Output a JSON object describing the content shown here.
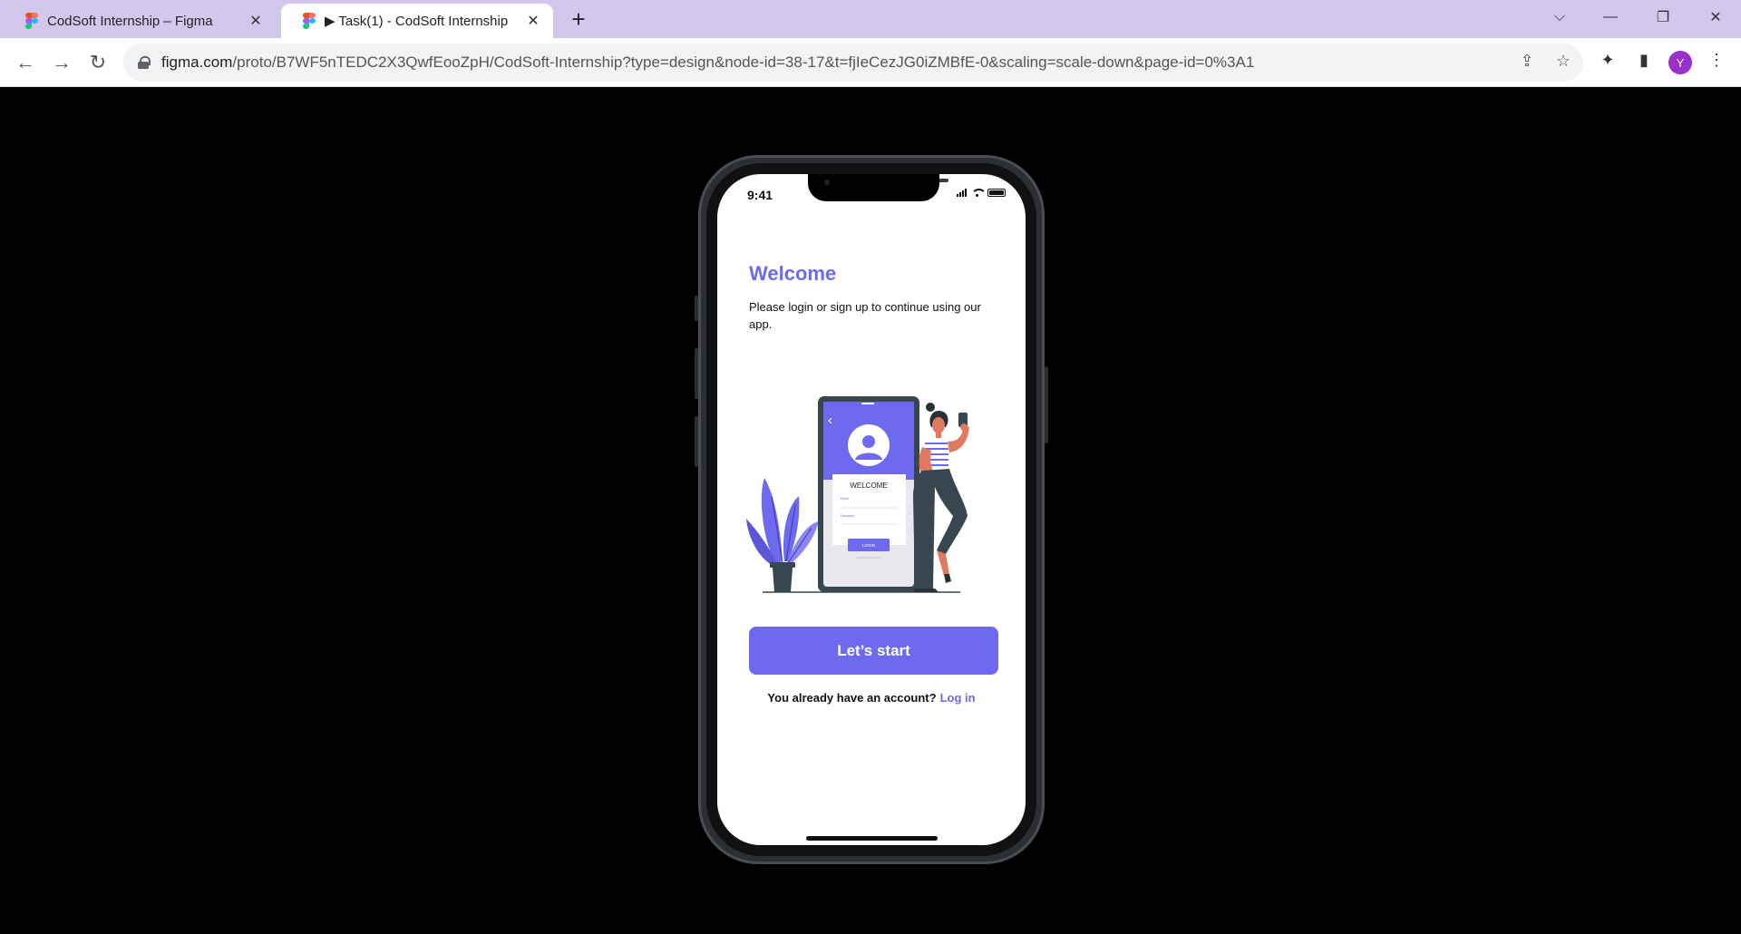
{
  "browser": {
    "tabs": [
      {
        "title": "CodSoft Internship – Figma",
        "active": false
      },
      {
        "title": "▶ Task(1) - CodSoft Internship",
        "active": true
      }
    ],
    "new_tab_label": "+",
    "close_glyph": "✕",
    "window_controls": {
      "tab_search": "⌵",
      "minimize": "—",
      "restore": "❐",
      "close": "✕"
    },
    "nav": {
      "back": "←",
      "forward": "→",
      "reload": "↻"
    },
    "url_host": "figma.com",
    "url_path": "/proto/B7WF5nTEDC2X3QwfEooZpH/CodSoft-Internship?type=design&node-id=38-17&t=fjIeCezJG0iZMBfE-0&scaling=scale-down&page-id=0%3A1",
    "toolbar_icons": {
      "share": "⇪",
      "bookmark": "☆",
      "extensions": "✦",
      "side_panel": "▮"
    },
    "profile_initial": "Y"
  },
  "phone": {
    "status_time": "9:41",
    "title": "Welcome",
    "subtitle": "Please login or sign up to continue using our app.",
    "illustration": {
      "screen_heading": "WELCOME",
      "email_label": "Email",
      "password_label": "Password",
      "login_label": "LOGIN"
    },
    "primary_button": "Let’s start",
    "login_prompt": "You already have an account?",
    "login_link": "Log in"
  },
  "colors": {
    "accent": "#6e6af0",
    "tab_strip": "#d3c7ec",
    "profile": "#9b2fc9"
  }
}
